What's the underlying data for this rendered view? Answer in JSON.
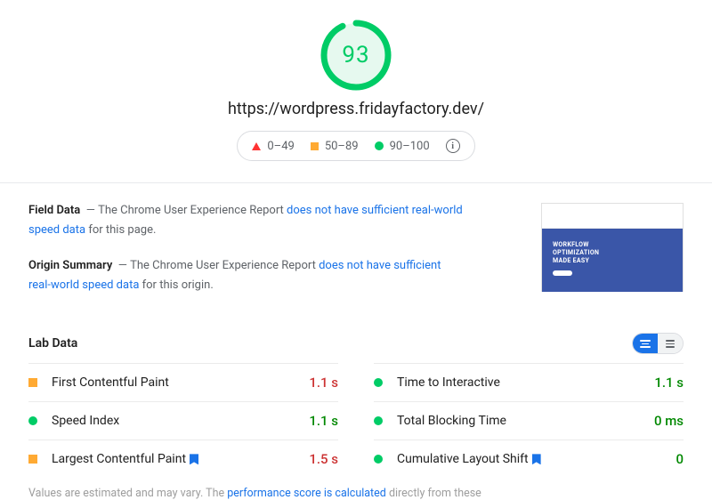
{
  "score": {
    "value": "93",
    "percent": 93,
    "color": "#00cc66",
    "bg": "#e6f9ef"
  },
  "url": "https://wordpress.fridayfactory.dev/",
  "legend": {
    "poor": "0–49",
    "mid": "50–89",
    "good": "90–100"
  },
  "field": {
    "title": "Field Data",
    "prefix": "The Chrome User Experience Report",
    "link": "does not have sufficient real-world speed data",
    "suffix": "for this page."
  },
  "origin": {
    "title": "Origin Summary",
    "prefix": "The Chrome User Experience Report",
    "link": "does not have sufficient real-world speed data",
    "suffix": "for this origin."
  },
  "screenshot": {
    "line1": "WORKFLOW",
    "line2": "OPTIMIZATION",
    "line3": "MADE EASY"
  },
  "lab": {
    "title": "Lab Data"
  },
  "metrics": [
    {
      "name": "First Contentful Paint",
      "value": "1.1 s",
      "status": "mid",
      "valcolor": "r",
      "flag": false
    },
    {
      "name": "Time to Interactive",
      "value": "1.1 s",
      "status": "good",
      "valcolor": "g",
      "flag": false
    },
    {
      "name": "Speed Index",
      "value": "1.1 s",
      "status": "good",
      "valcolor": "g",
      "flag": false
    },
    {
      "name": "Total Blocking Time",
      "value": "0 ms",
      "status": "good",
      "valcolor": "g",
      "flag": false
    },
    {
      "name": "Largest Contentful Paint",
      "value": "1.5 s",
      "status": "mid",
      "valcolor": "r",
      "flag": true
    },
    {
      "name": "Cumulative Layout Shift",
      "value": "0",
      "status": "good",
      "valcolor": "g",
      "flag": true
    }
  ],
  "footnote": {
    "prefix": "Values are estimated and may vary. The",
    "link": "performance score is calculated",
    "suffix": "directly from these"
  }
}
